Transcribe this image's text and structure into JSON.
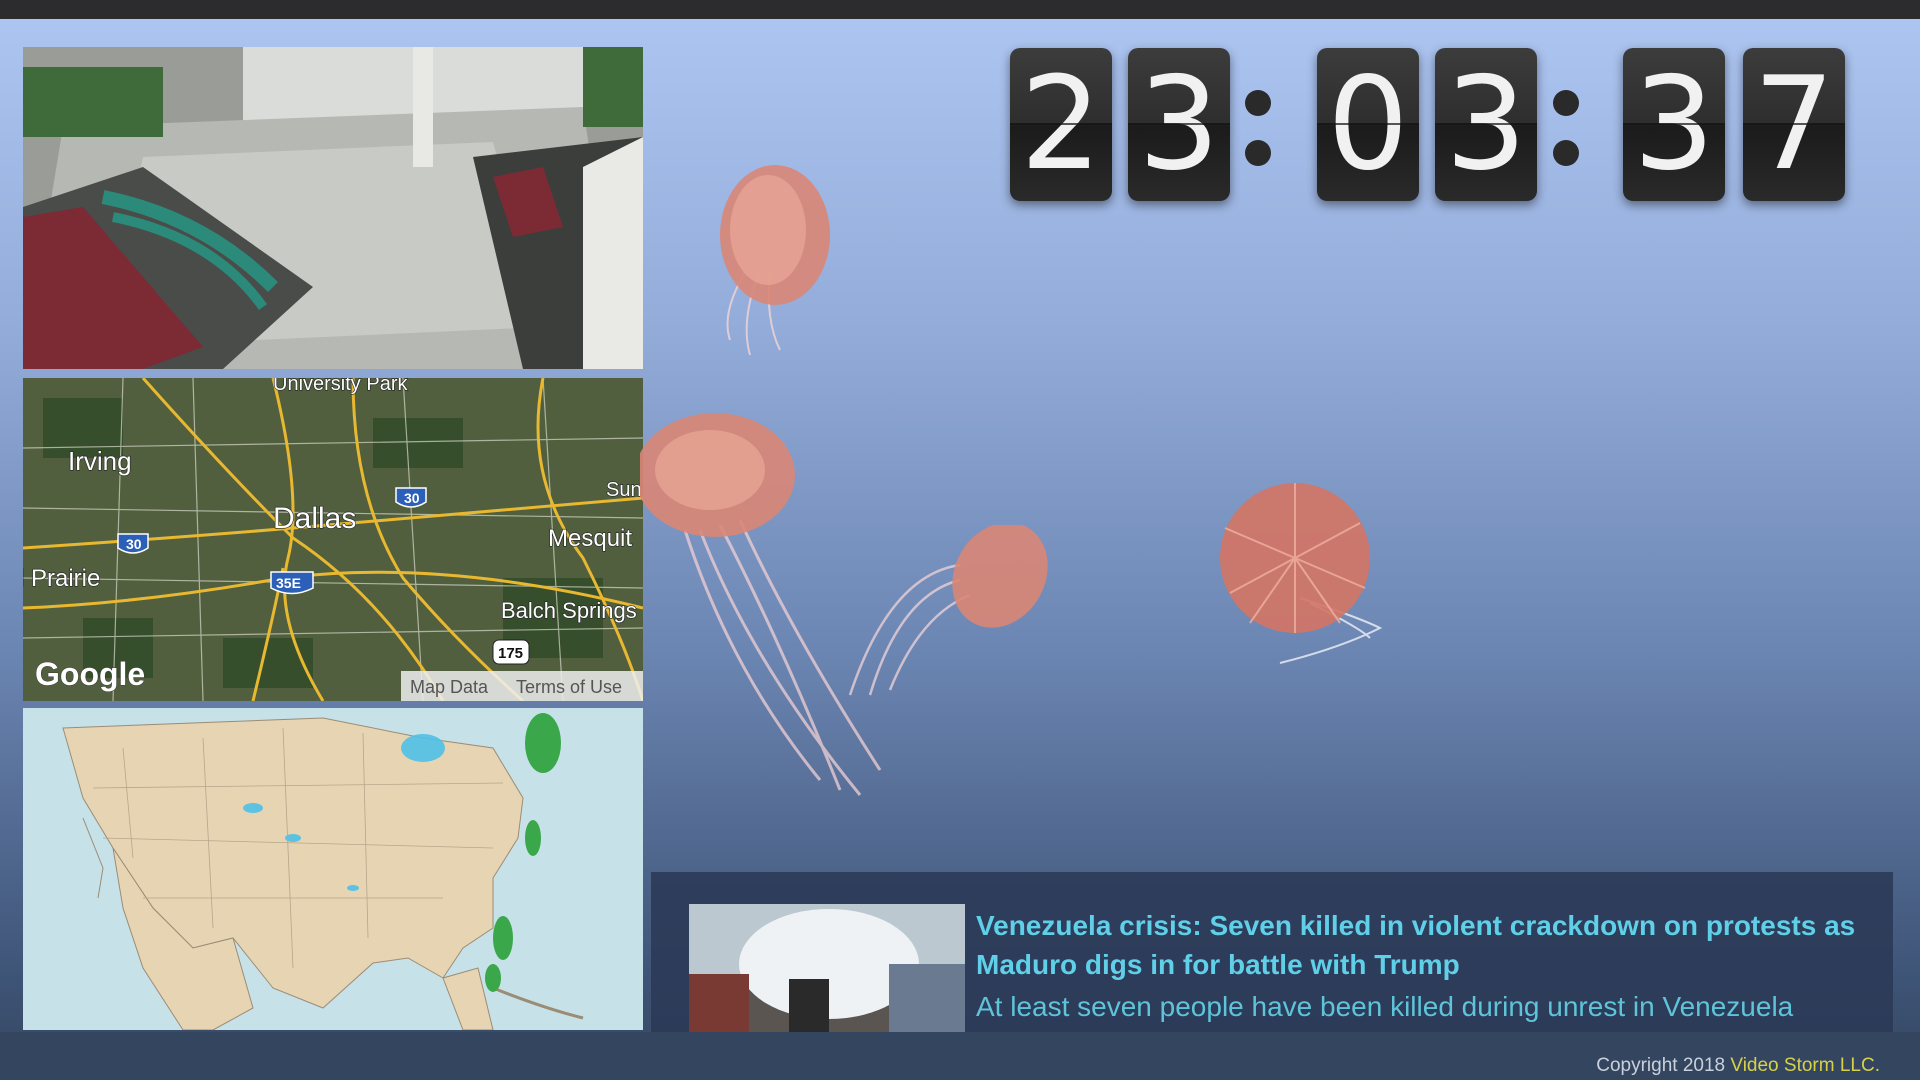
{
  "clock": {
    "digits": [
      "2",
      "3",
      "0",
      "3",
      "3",
      "7"
    ],
    "separator": ":"
  },
  "map": {
    "labels": {
      "university_park": "University Park",
      "irving": "Irving",
      "dallas": "Dallas",
      "sunnyvale": "Sun",
      "mesquite": "Mesquit",
      "prairie": "l Prairie",
      "balch_springs": "Balch Springs"
    },
    "shields": {
      "i30_a": "30",
      "i30_b": "30",
      "i35e": "35E",
      "us175": "175"
    },
    "logo": "Google",
    "map_data_link": "Map Data",
    "terms_link": "Terms of Use"
  },
  "news": {
    "headline": "Venezuela crisis: Seven killed in violent crackdown on protests as Maduro digs in for battle with Trump",
    "summary": "At least seven people have been killed during unrest in Venezuela"
  },
  "footer": {
    "copyright_prefix": "Copyright 2018 ",
    "brand": "Video Storm LLC."
  },
  "colors": {
    "headline": "#5fd0e8",
    "brand": "#d7d14a",
    "background_top": "#aec6f2",
    "background_bottom": "#34455f"
  }
}
